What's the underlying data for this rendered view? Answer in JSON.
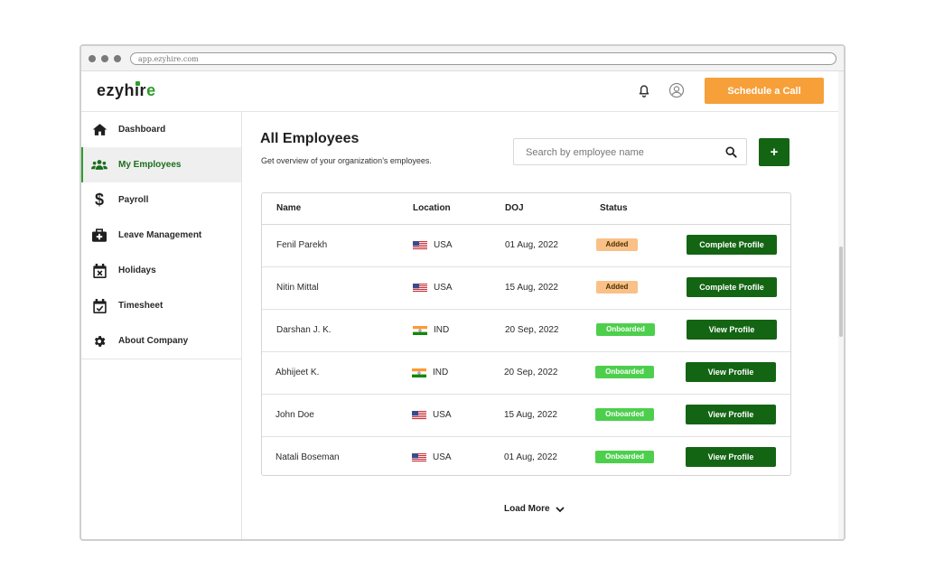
{
  "browser": {
    "url": "app.ezyhire.com"
  },
  "header": {
    "logo": {
      "part1": "ezyh",
      "part2": "i",
      "part3": "r",
      "part4": "e"
    },
    "schedule_label": "Schedule a Call"
  },
  "sidebar": {
    "items": [
      {
        "label": "Dashboard",
        "icon": "home-icon"
      },
      {
        "label": "My Employees",
        "icon": "users-icon",
        "active": true
      },
      {
        "label": "Payroll",
        "icon": "dollar-icon"
      },
      {
        "label": "Leave Management",
        "icon": "medical-kit-icon"
      },
      {
        "label": "Holidays",
        "icon": "calendar-x-icon"
      },
      {
        "label": "Timesheet",
        "icon": "calendar-check-icon"
      },
      {
        "label": "About Company",
        "icon": "gear-icon"
      }
    ]
  },
  "main": {
    "title": "All Employees",
    "subtitle": "Get overview of your organization’s employees.",
    "search_placeholder": "Search by employee name",
    "add_label": "+",
    "columns": [
      "Name",
      "Location",
      "DOJ",
      "Status"
    ],
    "rows": [
      {
        "name": "Fenil Parekh",
        "country": "USA",
        "doj": "01 Aug, 2022",
        "status": "Added",
        "action": "Complete Profile"
      },
      {
        "name": "Nitin Mittal",
        "country": "USA",
        "doj": "15 Aug, 2022",
        "status": "Added",
        "action": "Complete Profile"
      },
      {
        "name": "Darshan J. K.",
        "country": "IND",
        "doj": "20 Sep, 2022",
        "status": "Onboarded",
        "action": "View Profile"
      },
      {
        "name": "Abhijeet K.",
        "country": "IND",
        "doj": "20 Sep, 2022",
        "status": "Onboarded",
        "action": "View Profile"
      },
      {
        "name": "John Doe",
        "country": "USA",
        "doj": "15 Aug, 2022",
        "status": "Onboarded",
        "action": "View Profile"
      },
      {
        "name": "Natali Boseman",
        "country": "USA",
        "doj": "01 Aug, 2022",
        "status": "Onboarded",
        "action": "View Profile"
      }
    ],
    "load_more_label": "Load More"
  },
  "colors": {
    "brand_green": "#136513",
    "accent_green": "#2e9e2e",
    "orange": "#f7a03a",
    "added_badge": "#f9c087",
    "onboarded_badge": "#4dcf4d"
  }
}
